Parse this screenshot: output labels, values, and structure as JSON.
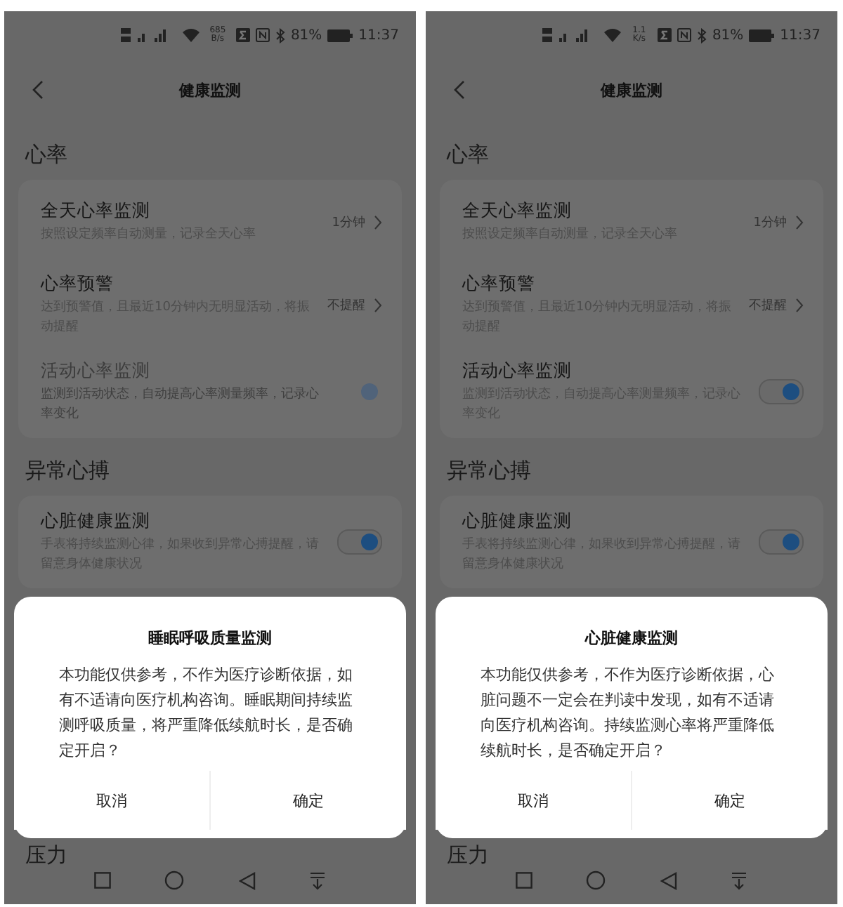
{
  "screens": [
    {
      "status_bar": {
        "network_speed": "685 B/s",
        "battery": "81%",
        "time": "11:37"
      },
      "header": {
        "title": "健康监测"
      },
      "sections": [
        {
          "title": "心率",
          "items": [
            {
              "kind": "link",
              "title": "全天心率监测",
              "description": "按照设定频率自动测量，记录全天心率",
              "value": "1分钟"
            },
            {
              "kind": "link",
              "title": "心率预警",
              "description": "达到预警值，且最近10分钟内无明显活动，将振动提醒",
              "value": "不提醒"
            },
            {
              "kind": "toggle",
              "title": "活动心率监测",
              "description": "监测到活动状态，自动提高心率测量频率，记录心率变化",
              "on": true,
              "disabled": true
            }
          ]
        },
        {
          "title": "异常心搏",
          "items": [
            {
              "kind": "toggle",
              "title": "心脏健康监测",
              "description": "手表将持续监测心律，如果收到异常心搏提醒，请留意身体健康状况",
              "on": true,
              "disabled": false
            }
          ]
        },
        {
          "title": "压力"
        }
      ],
      "dialog": {
        "title": "睡眠呼吸质量监测",
        "message": "本功能仅供参考，不作为医疗诊断依据，如有不适请向医疗机构咨询。睡眠期间持续监测呼吸质量，将严重降低续航时长，是否确定开启？",
        "buttons": [
          "取消",
          "确定"
        ]
      }
    },
    {
      "status_bar": {
        "network_speed": "1.1 K/s",
        "battery": "81%",
        "time": "11:37"
      },
      "header": {
        "title": "健康监测"
      },
      "sections": [
        {
          "title": "心率",
          "items": [
            {
              "kind": "link",
              "title": "全天心率监测",
              "description": "按照设定频率自动测量，记录全天心率",
              "value": "1分钟"
            },
            {
              "kind": "link",
              "title": "心率预警",
              "description": "达到预警值，且最近10分钟内无明显活动，将振动提醒",
              "value": "不提醒"
            },
            {
              "kind": "toggle",
              "title": "活动心率监测",
              "description": "监测到活动状态，自动提高心率测量频率，记录心率变化",
              "on": true,
              "disabled": false
            }
          ]
        },
        {
          "title": "异常心搏",
          "items": [
            {
              "kind": "toggle",
              "title": "心脏健康监测",
              "description": "手表将持续监测心律，如果收到异常心搏提醒，请留意身体健康状况",
              "on": true,
              "disabled": false
            }
          ]
        },
        {
          "title": "压力"
        }
      ],
      "dialog": {
        "title": "心脏健康监测",
        "message": "本功能仅供参考，不作为医疗诊断依据，心脏问题不一定会在判读中发现，如有不适请向医疗机构咨询。持续监测心率将严重降低续航时长，是否确定开启？",
        "buttons": [
          "取消",
          "确定"
        ]
      }
    }
  ]
}
